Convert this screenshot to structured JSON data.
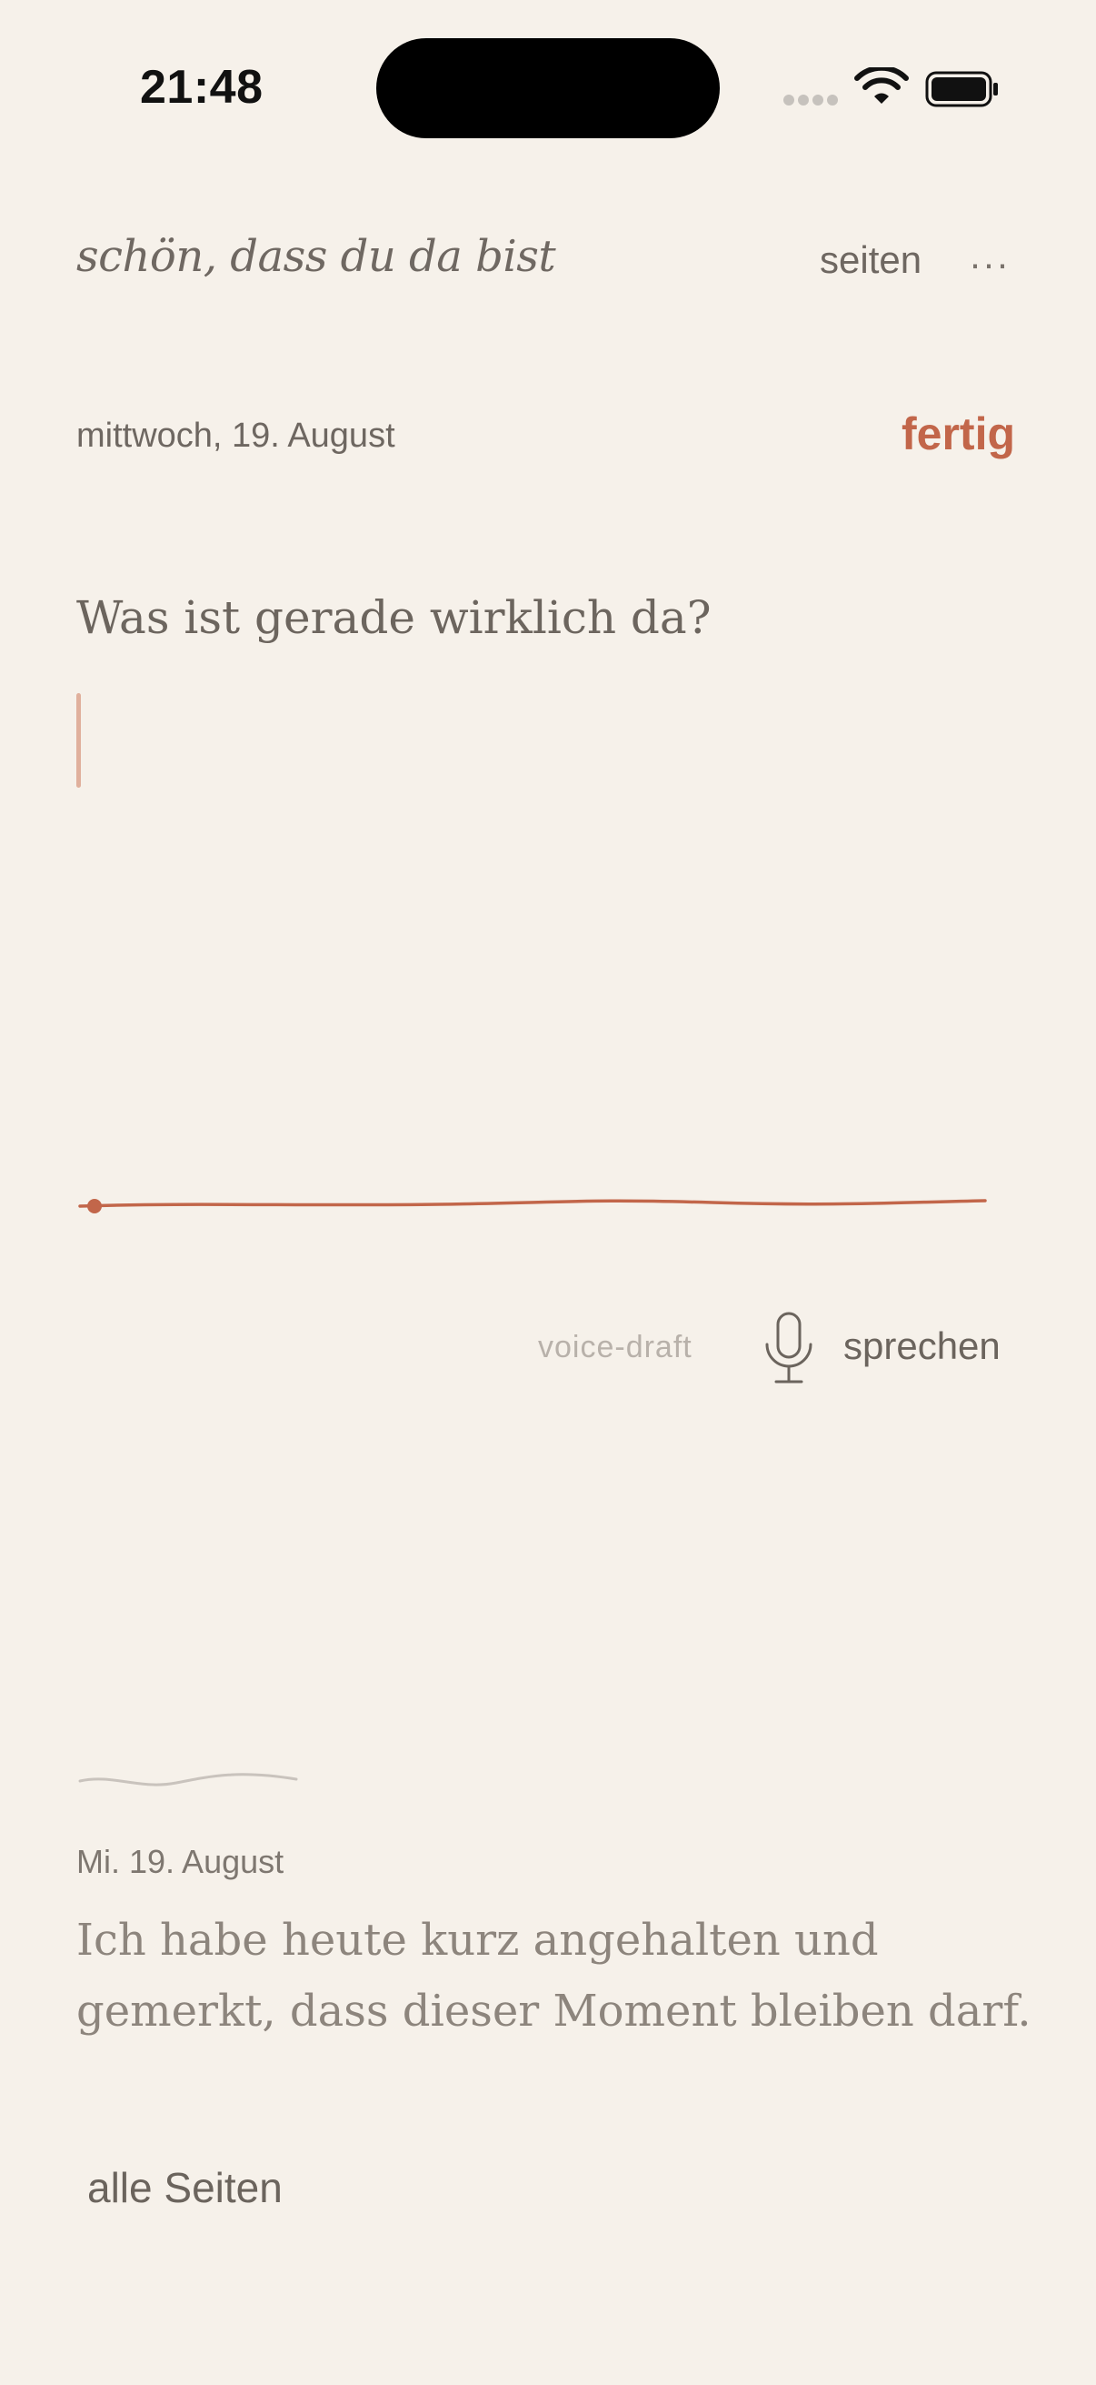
{
  "status_bar": {
    "time": "21:48",
    "icons": [
      "cellular-signal-icon",
      "wifi-icon",
      "battery-icon"
    ]
  },
  "header": {
    "greeting": "schön, dass du da bist",
    "pages_label": "seiten",
    "more_label": "···"
  },
  "entry_editor": {
    "date": "mittwoch, 19. August",
    "done_label": "fertig",
    "prompt": "Was ist gerade wirklich da?",
    "text": ""
  },
  "voice": {
    "draft_label": "voice-draft",
    "speak_label": "sprechen",
    "icon": "microphone-icon"
  },
  "previous_entry": {
    "date": "Mi. 19. August",
    "text": "Ich habe heute kurz angehalten und gemerkt, dass dieser Moment bleiben darf."
  },
  "footer": {
    "all_pages_label": "alle Seiten"
  },
  "colors": {
    "background": "#f6f1ea",
    "accent": "#c2664a",
    "text": "#6b645d",
    "muted": "#b8b1aa"
  }
}
